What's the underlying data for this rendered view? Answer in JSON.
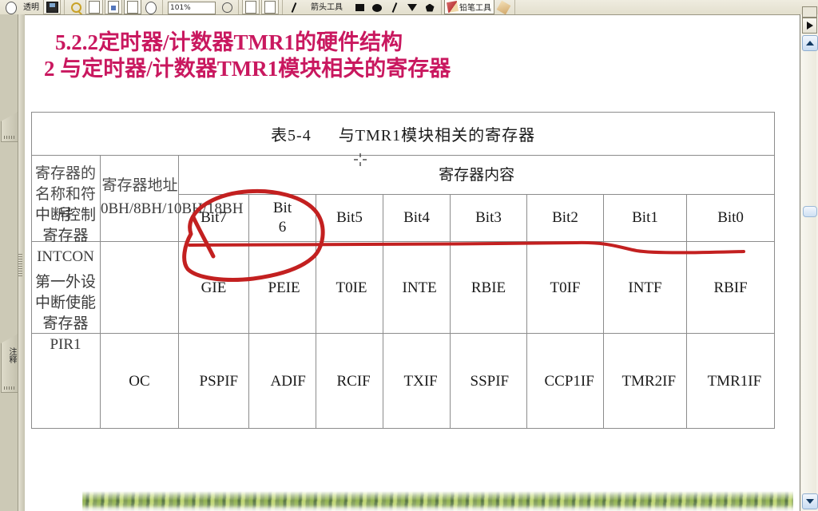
{
  "toolbar": {
    "groups": [
      {
        "name": "shapes-group",
        "items": [
          {
            "name": "ellipse-tool",
            "glyph": "ellipse-o-icon",
            "label": ""
          },
          {
            "name": "text-tool",
            "glyph": "text-cursor-icon",
            "label": "透明"
          },
          {
            "name": "image-tool",
            "glyph": "image-icon",
            "label": ""
          }
        ]
      },
      {
        "name": "view-group",
        "items": [
          {
            "name": "zoom-tool",
            "glyph": "magnifier-icon",
            "label": ""
          },
          {
            "name": "page-tool",
            "glyph": "page-icon",
            "label": ""
          },
          {
            "name": "insert-page-tool",
            "glyph": "page-insert-icon",
            "label": ""
          },
          {
            "name": "page-select-tool",
            "glyph": "page-sunken-icon",
            "label": ""
          },
          {
            "name": "shape-tool",
            "glyph": "ellipse-outline-icon",
            "label": ""
          }
        ]
      },
      {
        "name": "zoom-field-group",
        "items": [
          {
            "name": "zoom-value-field",
            "glyph": "",
            "label": "101%"
          },
          {
            "name": "clock-tool",
            "glyph": "clock-icon",
            "label": ""
          }
        ]
      },
      {
        "name": "page-nav-group",
        "items": [
          {
            "name": "prev-page-tool",
            "glyph": "page-prev-icon",
            "label": ""
          },
          {
            "name": "next-page-tool",
            "glyph": "page-next-icon",
            "label": ""
          }
        ]
      },
      {
        "name": "draw-group",
        "items": [
          {
            "name": "line-tool",
            "glyph": "slash-icon",
            "label": "箭头工具"
          },
          {
            "name": "rectangle-tool",
            "glyph": "filled-square-icon",
            "label": ""
          },
          {
            "name": "ellipse-filled-tool",
            "glyph": "filled-ellipse-icon",
            "label": ""
          },
          {
            "name": "diagonal-line-tool",
            "glyph": "slash-icon",
            "label": ""
          },
          {
            "name": "triangle-tool",
            "glyph": "triangle-down-icon",
            "label": ""
          },
          {
            "name": "pentagon-tool",
            "glyph": "pentagon-icon",
            "label": ""
          }
        ]
      },
      {
        "name": "pen-group",
        "items": [
          {
            "name": "pencil-tool",
            "glyph": "pencil-icon",
            "label": "铅笔工具"
          },
          {
            "name": "eraser-tool",
            "glyph": "eraser-icon",
            "label": ""
          }
        ]
      }
    ],
    "zoom_value": "101%",
    "arrow_tool_label": "箭头工具",
    "pencil_tool_label": "铅笔工具",
    "transparent_label": "透明"
  },
  "sidebar": {
    "notes_tab_label": "注释",
    "top_tab_label": ""
  },
  "scrollbar": {
    "next_page_glyph": "triangle-right-icon",
    "up_glyph": "chevron-up-icon",
    "down_glyph": "chevron-down-icon"
  },
  "slide": {
    "title_line1": "5.2.2定时器/计数器TMR1的硬件结构",
    "title_line2": "2 与定时器/计数器TMR1模块相关的寄存器",
    "title_color": "#c9185f"
  },
  "table": {
    "caption_number": "表5-4",
    "caption_text": "与TMR1模块相关的寄存器",
    "header_col_a": "寄存器的名称和符号",
    "header_col_b": "寄存器地址",
    "header_content": "寄存器内容",
    "bit_headers": [
      "Bit7",
      "Bit 6",
      "Bit5",
      "Bit4",
      "Bit3",
      "Bit2",
      "Bit1",
      "Bit0"
    ],
    "rows": [
      {
        "name": "中断控制寄存器 INTCON",
        "address": "0BH/8BH/10BH/18BH",
        "bits": [
          "GIE",
          "PEIE",
          "T0IE",
          "INTE",
          "RBIE",
          "T0IF",
          "INTF",
          "RBIF"
        ]
      },
      {
        "name": "第一外设中断使能寄存器 PIR1",
        "address": "OC",
        "bits": [
          "PSPIF",
          "ADIF",
          "RCIF",
          "TXIF",
          "SSPIF",
          "CCP1IF",
          "TMR2IF",
          "TMR1IF"
        ]
      }
    ]
  },
  "annotation": {
    "ink_color": "#c32020",
    "shapes": [
      "ellipse-around-gie-peie",
      "horizontal-underline-stroke",
      "short-diagonal-stroke"
    ]
  }
}
